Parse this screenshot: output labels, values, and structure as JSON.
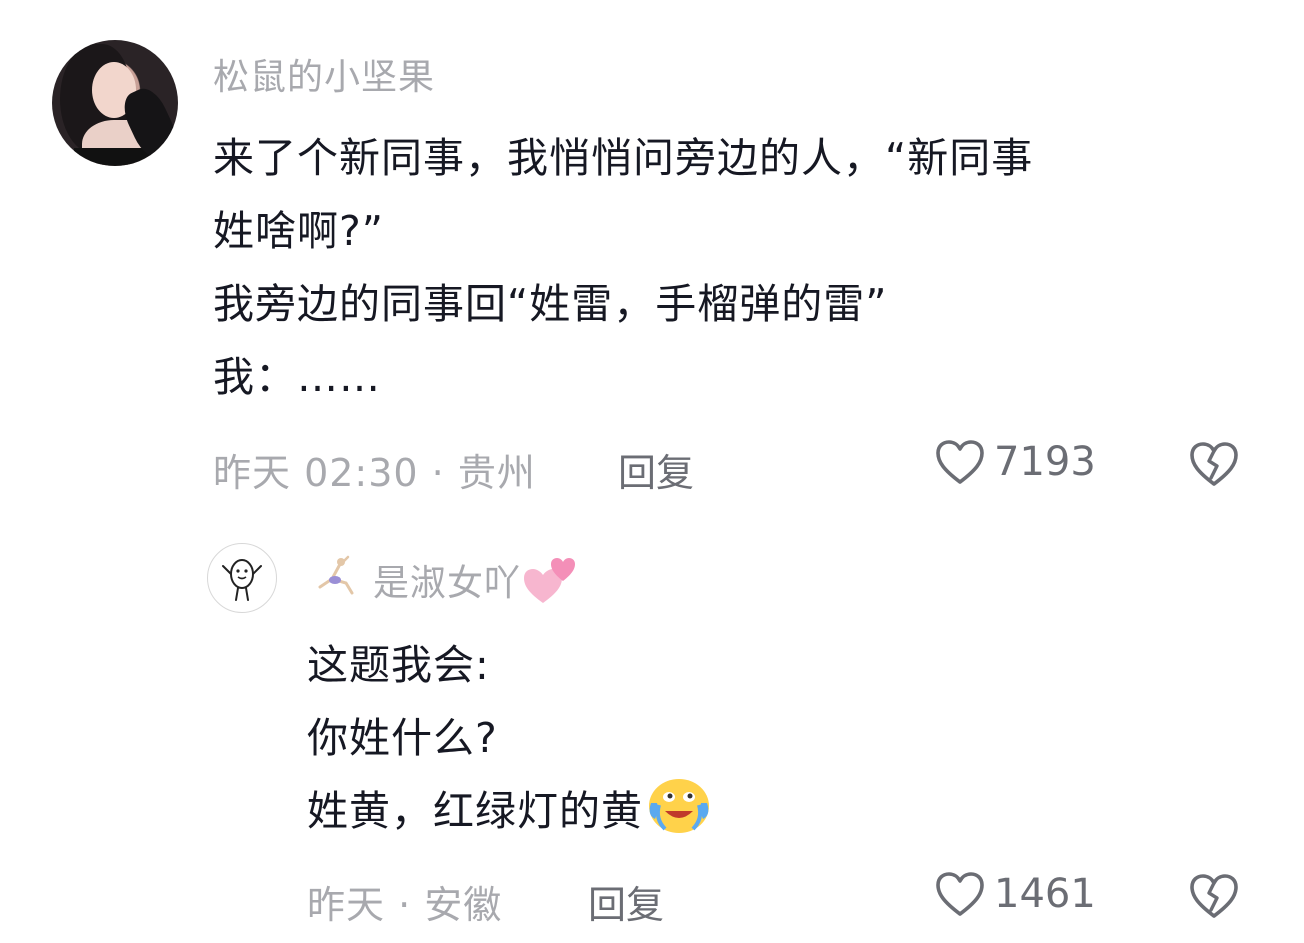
{
  "comments": [
    {
      "username": "松鼠的小坚果",
      "lines": [
        "来了个新同事，我悄悄问旁边的人，“新同事",
        "姓啥啊?”",
        "我旁边的同事回“姓雷，手榴弹的雷”",
        "我：……"
      ],
      "meta": "昨天 02:30 · 贵州",
      "reply_label": "回复",
      "likes": "7193"
    }
  ],
  "replies": [
    {
      "username": "是淑女吖",
      "lines": [
        "这题我会:",
        "你姓什么?",
        "姓黄，红绿灯的黄"
      ],
      "meta": "昨天 · 安徽",
      "reply_label": "回复",
      "likes": "1461"
    }
  ],
  "icons": {
    "like": "heart-outline-icon",
    "dislike": "broken-heart-icon",
    "name_suffix_emoji": "two-hearts-emoji",
    "text_emoji": "crying-laughing-emoji",
    "badge": "gymnast-badge-icon"
  },
  "colors": {
    "text_primary": "#161823",
    "text_secondary": "#a8a9ae",
    "action": "#6b6d74",
    "hearts_pink": "#f7a8c8"
  }
}
